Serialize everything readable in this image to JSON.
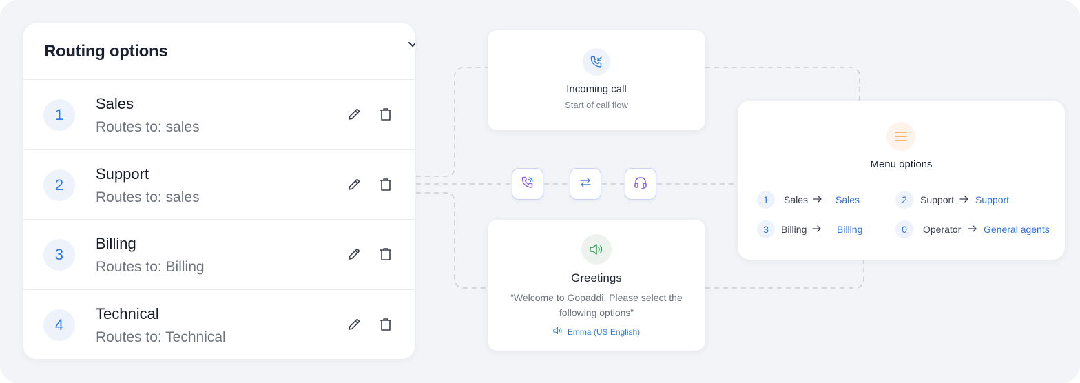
{
  "routing": {
    "title": "Routing options",
    "rows": [
      {
        "number": "1",
        "name": "Sales",
        "routes": "Routes to: sales"
      },
      {
        "number": "2",
        "name": "Support",
        "routes": "Routes to: sales"
      },
      {
        "number": "3",
        "name": "Billing",
        "routes": "Routes to: Billing"
      },
      {
        "number": "4",
        "name": "Technical",
        "routes": "Routes to: Technical"
      }
    ]
  },
  "incoming": {
    "icon": "phone-incoming-icon",
    "title": "Incoming call",
    "subtitle": "Start of call flow"
  },
  "greetings": {
    "icon": "speaker-icon",
    "title": "Greetings",
    "message_line1": "“Welcome to Gopaddi. Please select the",
    "message_line2": "following options”",
    "voice": "Emma (US English)"
  },
  "connector_icons": [
    "phone-call-icon",
    "transfer-arrows-icon",
    "headset-icon"
  ],
  "menu": {
    "icon": "menu-lines-icon",
    "title": "Menu options",
    "items": [
      {
        "number": "1",
        "label": "Sales",
        "target": "Sales"
      },
      {
        "number": "2",
        "label": "Support",
        "target": "Support"
      },
      {
        "number": "3",
        "label": "Billing",
        "target": "Billing"
      },
      {
        "number": "0",
        "label": "Operator",
        "target": "General agents"
      }
    ]
  },
  "colors": {
    "accent_blue": "#2f7ae5",
    "canvas_bg": "#f3f4f8",
    "menu_icon_orange": "#f5a14a",
    "greetings_icon_green": "#2e9b52"
  }
}
